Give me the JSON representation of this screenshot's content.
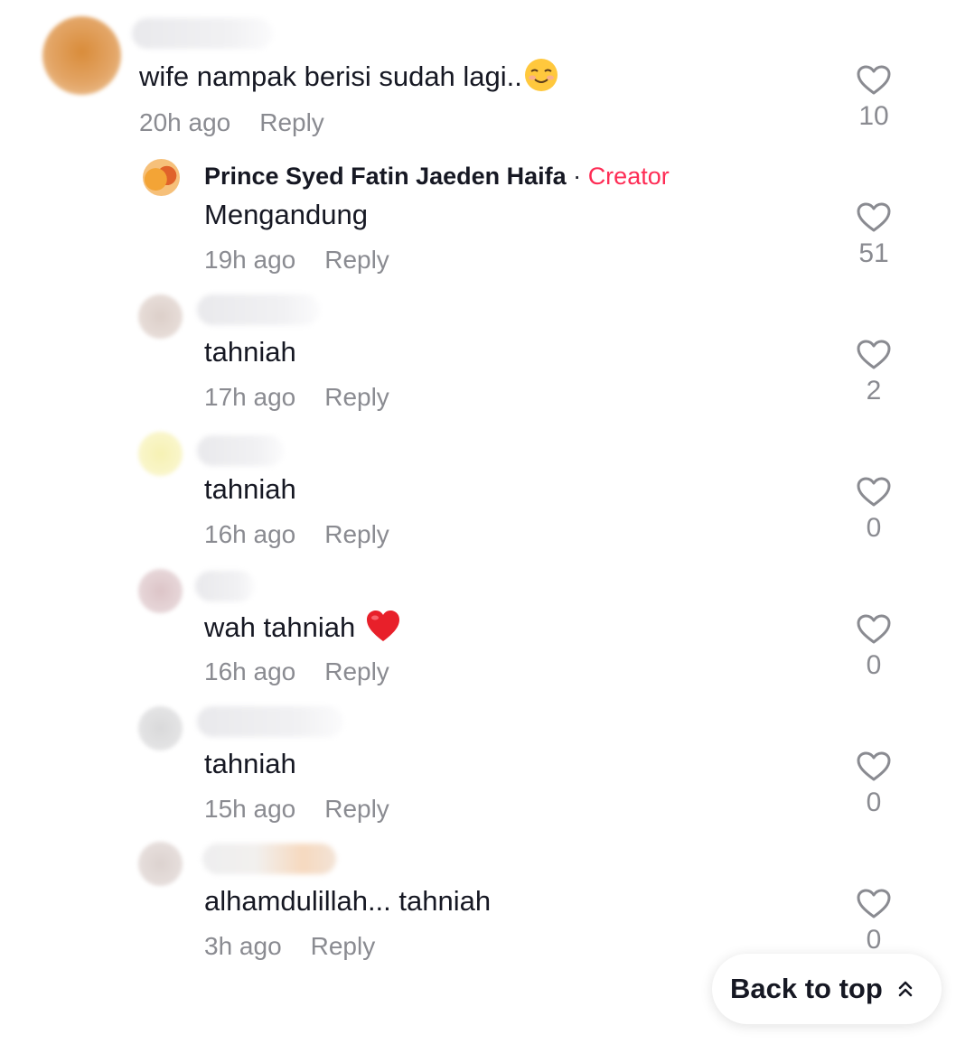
{
  "comments": [
    {
      "text": "wife nampak berisi sudah lagi..",
      "emoji": "smiling-face",
      "time": "20h ago",
      "reply": "Reply",
      "likes": "10"
    },
    {
      "author": "Prince Syed Fatin Jaeden Haifa",
      "separator": "·",
      "badge": "Creator",
      "text": "Mengandung",
      "time": "19h ago",
      "reply": "Reply",
      "likes": "51"
    },
    {
      "text": "tahniah",
      "time": "17h ago",
      "reply": "Reply",
      "likes": "2"
    },
    {
      "text": "tahniah",
      "time": "16h ago",
      "reply": "Reply",
      "likes": "0"
    },
    {
      "text": "wah tahniah",
      "emoji": "red-heart",
      "time": "16h ago",
      "reply": "Reply",
      "likes": "0"
    },
    {
      "text": "tahniah",
      "time": "15h ago",
      "reply": "Reply",
      "likes": "0"
    },
    {
      "text": "alhamdulillah... tahniah",
      "time": "3h ago",
      "reply": "Reply",
      "likes": "0"
    }
  ],
  "back_to_top": {
    "label": "Back to top",
    "icon": "double-chevron-up-icon"
  },
  "colors": {
    "creator": "#fe2c55",
    "meta": "#8a8b91",
    "text": "#161823"
  }
}
